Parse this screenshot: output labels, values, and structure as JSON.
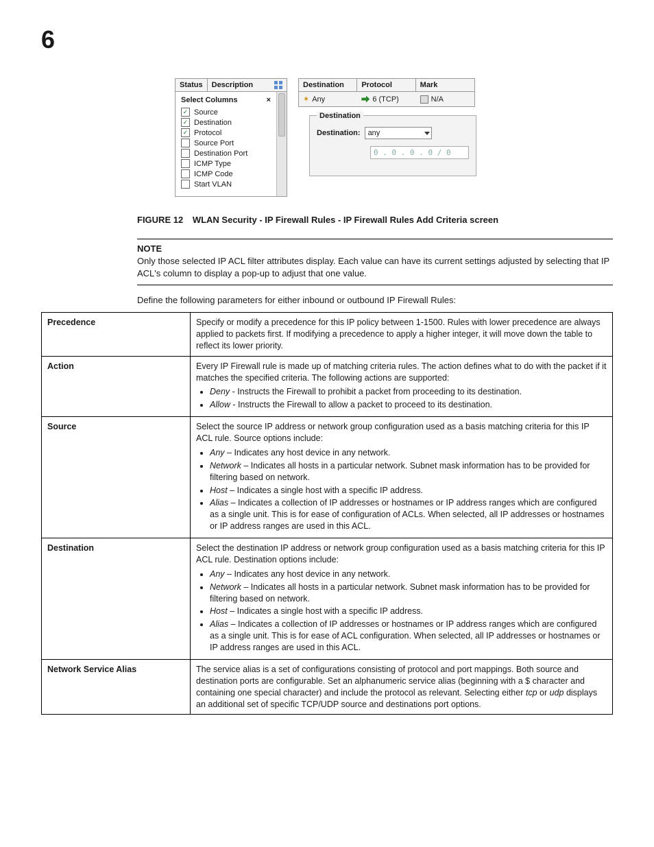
{
  "chapter": "6",
  "screenshot": {
    "left_headers": {
      "status": "Status",
      "description": "Description"
    },
    "select_columns": {
      "title": "Select Columns",
      "items": [
        {
          "label": "Source",
          "checked": true
        },
        {
          "label": "Destination",
          "checked": true
        },
        {
          "label": "Protocol",
          "checked": true
        },
        {
          "label": "Source Port",
          "checked": false
        },
        {
          "label": "Destination Port",
          "checked": false
        },
        {
          "label": "ICMP Type",
          "checked": false
        },
        {
          "label": "ICMP Code",
          "checked": false
        },
        {
          "label": "Start VLAN",
          "checked": false
        }
      ]
    },
    "grid": {
      "headers": {
        "destination": "Destination",
        "protocol": "Protocol",
        "mark": "Mark"
      },
      "row": {
        "destination": "Any",
        "protocol": "6 (TCP)",
        "mark": "N/A"
      }
    },
    "dest_box": {
      "title": "Destination",
      "label": "Destination:",
      "value": "any",
      "ip": "0 . 0 . 0 . 0 / 0"
    }
  },
  "figure": {
    "label": "FIGURE 12",
    "caption": "WLAN Security - IP Firewall Rules - IP Firewall Rules Add Criteria screen"
  },
  "note": {
    "title": "NOTE",
    "body": "Only those selected IP ACL filter attributes display. Each value can have its current settings adjusted by selecting that IP ACL's column to display a pop-up to adjust that one value."
  },
  "intro": "Define the following parameters for either inbound or outbound IP Firewall Rules:",
  "rows": {
    "precedence": {
      "name": "Precedence",
      "body": "Specify or modify a precedence for this IP policy between 1-1500. Rules with lower precedence are always applied to packets first. If modifying a precedence to apply a higher integer, it will move down the table to reflect its lower priority."
    },
    "action": {
      "name": "Action",
      "intro": "Every IP Firewall rule is made up of matching criteria rules. The action defines what to do with the packet if it matches the specified criteria. The following actions are supported:",
      "deny_lbl": "Deny",
      "deny_txt": " - Instructs the Firewall to prohibit a packet from proceeding to its destination.",
      "allow_lbl": "Allow",
      "allow_txt": " - Instructs the Firewall to allow a packet to proceed to its destination."
    },
    "source": {
      "name": "Source",
      "intro": "Select the source IP address or network group configuration used as a basis matching criteria for this IP ACL rule. Source options include:",
      "any_lbl": "Any",
      "any_txt": " – Indicates any host device in any network.",
      "net_lbl": "Network",
      "net_txt": " – Indicates all hosts in a particular network. Subnet mask information has to be provided for filtering based on network.",
      "host_lbl": "Host",
      "host_txt": " – Indicates a single host with a specific IP address.",
      "alias_lbl": "Alias",
      "alias_txt": " – Indicates a collection of IP addresses or hostnames or IP address ranges which are configured as a single unit. This is for ease of configuration of ACLs. When selected, all IP addresses or hostnames or IP address ranges are used in this ACL."
    },
    "destination": {
      "name": "Destination",
      "intro": "Select the destination IP address or network group configuration used as a basis matching criteria for this IP ACL rule. Destination options include:",
      "any_lbl": "Any",
      "any_txt": " – Indicates any host device in any network.",
      "net_lbl": "Network",
      "net_txt": " – Indicates all hosts in a particular network. Subnet mask information has to be provided for filtering based on network.",
      "host_lbl": "Host",
      "host_txt": " – Indicates a single host with a specific IP address.",
      "alias_lbl": "Alias",
      "alias_txt": " – Indicates a collection of IP addresses or hostnames or IP address ranges which are configured as a single unit. This is for ease of ACL configuration. When selected, all IP addresses or hostnames or IP address ranges are used in this ACL."
    },
    "nsa": {
      "name": "Network Service Alias",
      "pre": "The service alias is a set of configurations consisting of protocol and port mappings. Both source and destination ports are configurable. Set an alphanumeric service alias (beginning with a $ character and containing one special character) and include the protocol as relevant. Selecting either ",
      "i1": "tcp",
      "mid": " or ",
      "i2": "udp",
      "post": " displays an additional set of specific TCP/UDP source and destinations port options."
    }
  }
}
